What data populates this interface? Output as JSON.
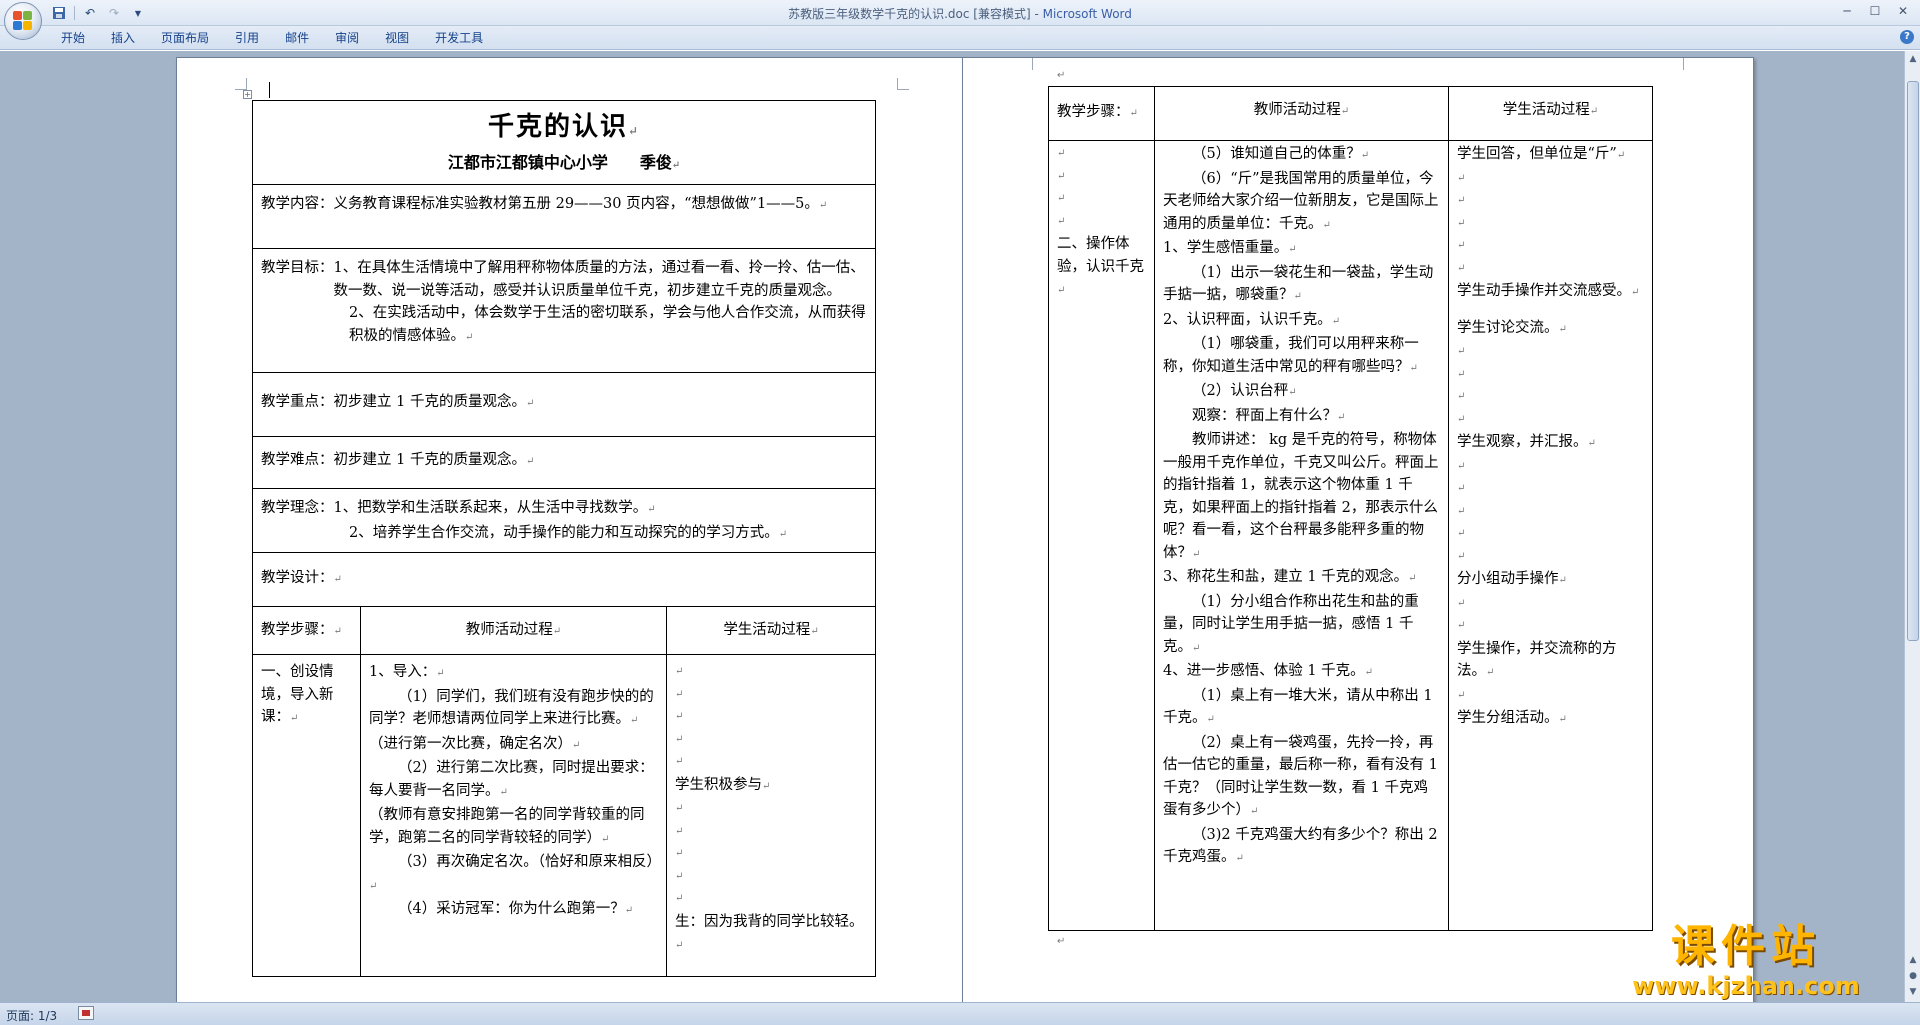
{
  "window": {
    "title": "苏教版三年级数学千克的认识.doc [兼容模式] - ",
    "app_name": "Microsoft Word"
  },
  "qat": {
    "save_icon": "save-icon",
    "undo_icon": "undo-icon",
    "redo_icon": "redo-icon",
    "customize_icon": "dropdown-icon"
  },
  "ribbon": {
    "tabs": [
      "开始",
      "插入",
      "页面布局",
      "引用",
      "邮件",
      "审阅",
      "视图",
      "开发工具"
    ]
  },
  "page1": {
    "title": "千克的认识",
    "subtitle": "江都市江都镇中心小学　　季俊",
    "content": "教学内容：义务教育课程标准实验教材第五册 29——30 页内容，“想想做做”1——5。",
    "goal_label": "教学目标：",
    "goal1": "1、在具体生活情境中了解用秤称物体质量的方法，通过看一看、拎一拎、估一估、数一数、说一说等活动，感受并认识质量单位千克，初步建立千克的质量观念。",
    "goal2": "2、在实践活动中，体会数学于生活的密切联系，学会与他人合作交流，从而获得积极的情感体验。",
    "key": "教学重点：初步建立 1 千克的质量观念。",
    "difficulty": "教学难点：初步建立 1 千克的质量观念。",
    "idea_label": "教学理念：",
    "idea1": "1、把数学和生活联系起来，从生活中寻找数学。",
    "idea2": "2、培养学生合作交流，动手操作的能力和互动探究的的学习方式。",
    "design": "教学设计：",
    "header_step": "教学步骤：",
    "header_teacher": "教师活动过程",
    "header_student": "学生活动过程",
    "step1": "一、创设情境，导入新课：",
    "teacher_lines": [
      "1、导入：",
      "（1）同学们，我们班有没有跑步快的的同学？老师想请两位同学上来进行比赛。",
      "（进行第一次比赛，确定名次）",
      "（2）进行第二次比赛，同时提出要求：每人要背一名同学。",
      "（教师有意安排跑第一名的同学背较重的同学，跑第二名的同学背较轻的同学）",
      "（3）再次确定名次。（恰好和原来相反）",
      "（4）采访冠军：你为什么跑第一？"
    ],
    "student_a": "学生积极参与",
    "student_b": "生：因为我背的同学比较轻。"
  },
  "page2": {
    "header_step": "教学步骤：",
    "header_teacher": "教师活动过程",
    "header_student": "学生活动过程",
    "step2": "二、操作体验，认识千克",
    "teacher_lines": [
      "（5）谁知道自己的体重？",
      "（6）“斤”是我国常用的质量单位，今天老师给大家介绍一位新朋友，它是国际上通用的质量单位：千克。",
      "1、学生感悟重量。",
      "（1）出示一袋花生和一袋盐，学生动手掂一掂，哪袋重？",
      "2、认识秤面，认识千克。",
      "（1）哪袋重，我们可以用秤来称一称，你知道生活中常见的秤有哪些吗？",
      "（2）认识台秤",
      "观察：秤面上有什么？",
      "教师讲述： kg 是千克的符号，称物体一般用千克作单位，千克又叫公斤。秤面上的指针指着 1，就表示这个物体重 1 千克，如果秤面上的指针指着 2，那表示什么呢？看一看，这个台秤最多能秤多重的物体？",
      "3、称花生和盐，建立 1 千克的观念。",
      "（1）分小组合作称出花生和盐的重量，同时让学生用手掂一掂，感悟 1 千克。",
      "4、进一步感悟、体验 1 千克。",
      "（1）桌上有一堆大米，请从中称出 1 千克。",
      "（2）桌上有一袋鸡蛋，先拎一拎，再估一估它的重量，最后称一称，看有没有 1 千克？（同时让学生数一数，看 1 千克鸡蛋有多少个）",
      "（3)2 千克鸡蛋大约有多少个？称出 2 千克鸡蛋。"
    ],
    "student_lines": [
      "学生回答，但单位是“斤”",
      "学生动手操作并交流感受。",
      "学生讨论交流。",
      "学生观察，并汇报。",
      "分小组动手操作",
      "学生操作，并交流称的方法。",
      "学生分组活动。"
    ]
  },
  "status": {
    "pages": "页面: 1/3"
  },
  "watermark": {
    "text": "课件站",
    "url": "www.kjzhan.com"
  }
}
